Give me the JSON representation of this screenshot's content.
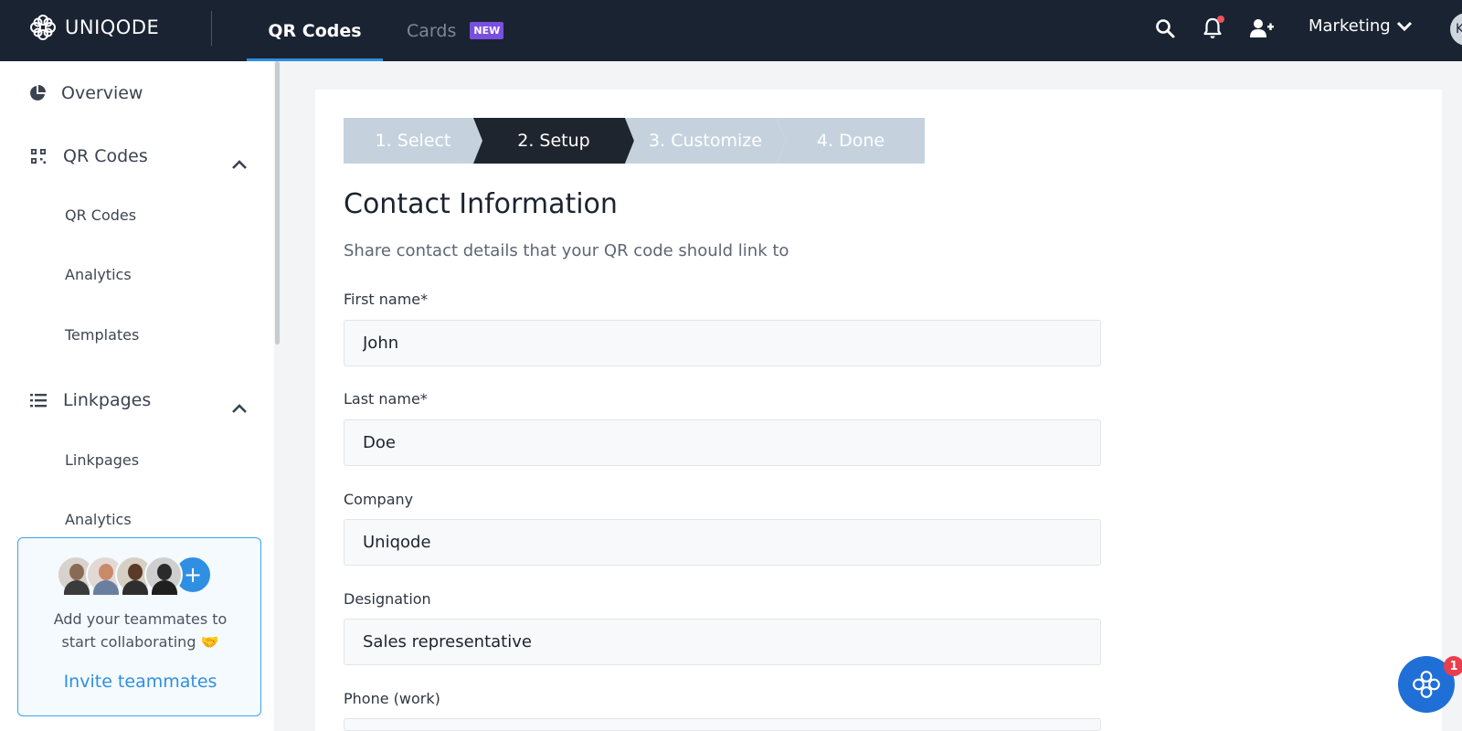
{
  "topbar": {
    "logo_text": "UNIQODE",
    "nav_qr": "QR Codes",
    "nav_cards": "Cards",
    "badge_new": "NEW",
    "workspace": "Marketing",
    "avatar_initial": "K"
  },
  "sidebar": {
    "overview": "Overview",
    "qr_group": "QR Codes",
    "qr_sub": [
      "QR Codes",
      "Analytics",
      "Templates"
    ],
    "link_group": "Linkpages",
    "link_sub": [
      "Linkpages",
      "Analytics"
    ],
    "invite_text_line1": "Add your teammates to",
    "invite_text_line2": "start collaborating 🤝",
    "invite_link": "Invite teammates"
  },
  "stepper": {
    "steps": [
      "1. Select",
      "2. Setup",
      "3. Customize",
      "4. Done"
    ],
    "active_index": 1
  },
  "form": {
    "title": "Contact Information",
    "subtitle": "Share contact details that your QR code should link to",
    "fields": [
      {
        "label": "First name*",
        "value": "John"
      },
      {
        "label": "Last name*",
        "value": "Doe"
      },
      {
        "label": "Company",
        "value": "Uniqode"
      },
      {
        "label": "Designation",
        "value": "Sales representative"
      },
      {
        "label": "Phone (work)",
        "value": ""
      }
    ]
  },
  "chat": {
    "badge_count": "1"
  },
  "colors": {
    "topbar_bg": "#1a2332",
    "accent": "#2f8fe3",
    "step_active": "#1f252e",
    "step_inactive": "#c5d2de",
    "badge_new": "#7a4fe0"
  }
}
